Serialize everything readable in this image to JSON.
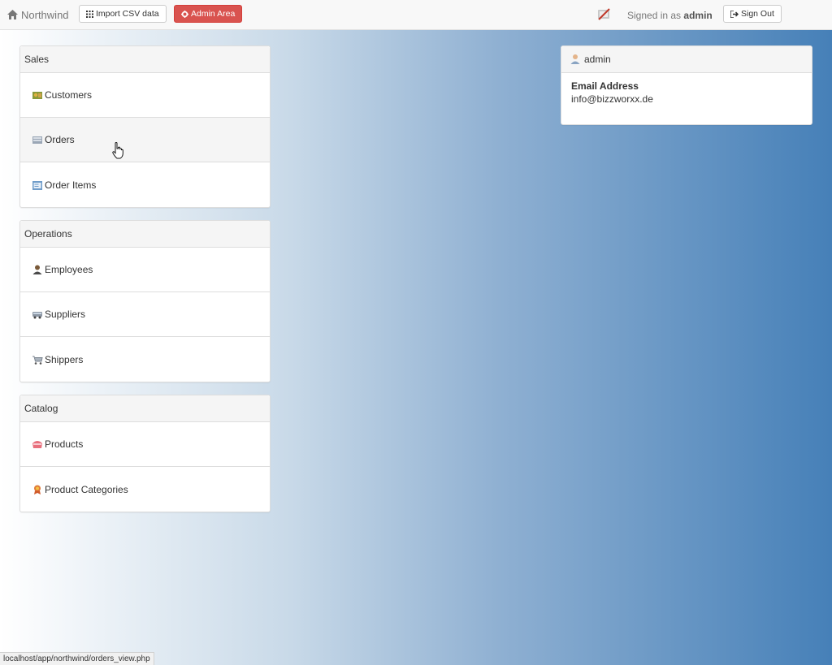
{
  "navbar": {
    "brand": "Northwind",
    "import_button": "Import CSV data",
    "admin_button": "Admin Area",
    "signed_in_prefix": "Signed in as",
    "username": "admin",
    "signout_button": "Sign Out"
  },
  "groups": [
    {
      "title": "Sales",
      "items": [
        {
          "label": "Customers",
          "icon": "customers-icon"
        },
        {
          "label": "Orders",
          "icon": "orders-icon"
        },
        {
          "label": "Order Items",
          "icon": "order-items-icon"
        }
      ]
    },
    {
      "title": "Operations",
      "items": [
        {
          "label": "Employees",
          "icon": "employees-icon"
        },
        {
          "label": "Suppliers",
          "icon": "suppliers-icon"
        },
        {
          "label": "Shippers",
          "icon": "shippers-icon"
        }
      ]
    },
    {
      "title": "Catalog",
      "items": [
        {
          "label": "Products",
          "icon": "products-icon"
        },
        {
          "label": "Product Categories",
          "icon": "product-categories-icon"
        }
      ]
    }
  ],
  "user_panel": {
    "name": "admin",
    "email_label": "Email Address",
    "email": "info@bizzworxx.de"
  },
  "status_bar": "localhost/app/northwind/orders_view.php",
  "colors": {
    "danger": "#d9534f",
    "gradient_end": "#4680b8"
  }
}
